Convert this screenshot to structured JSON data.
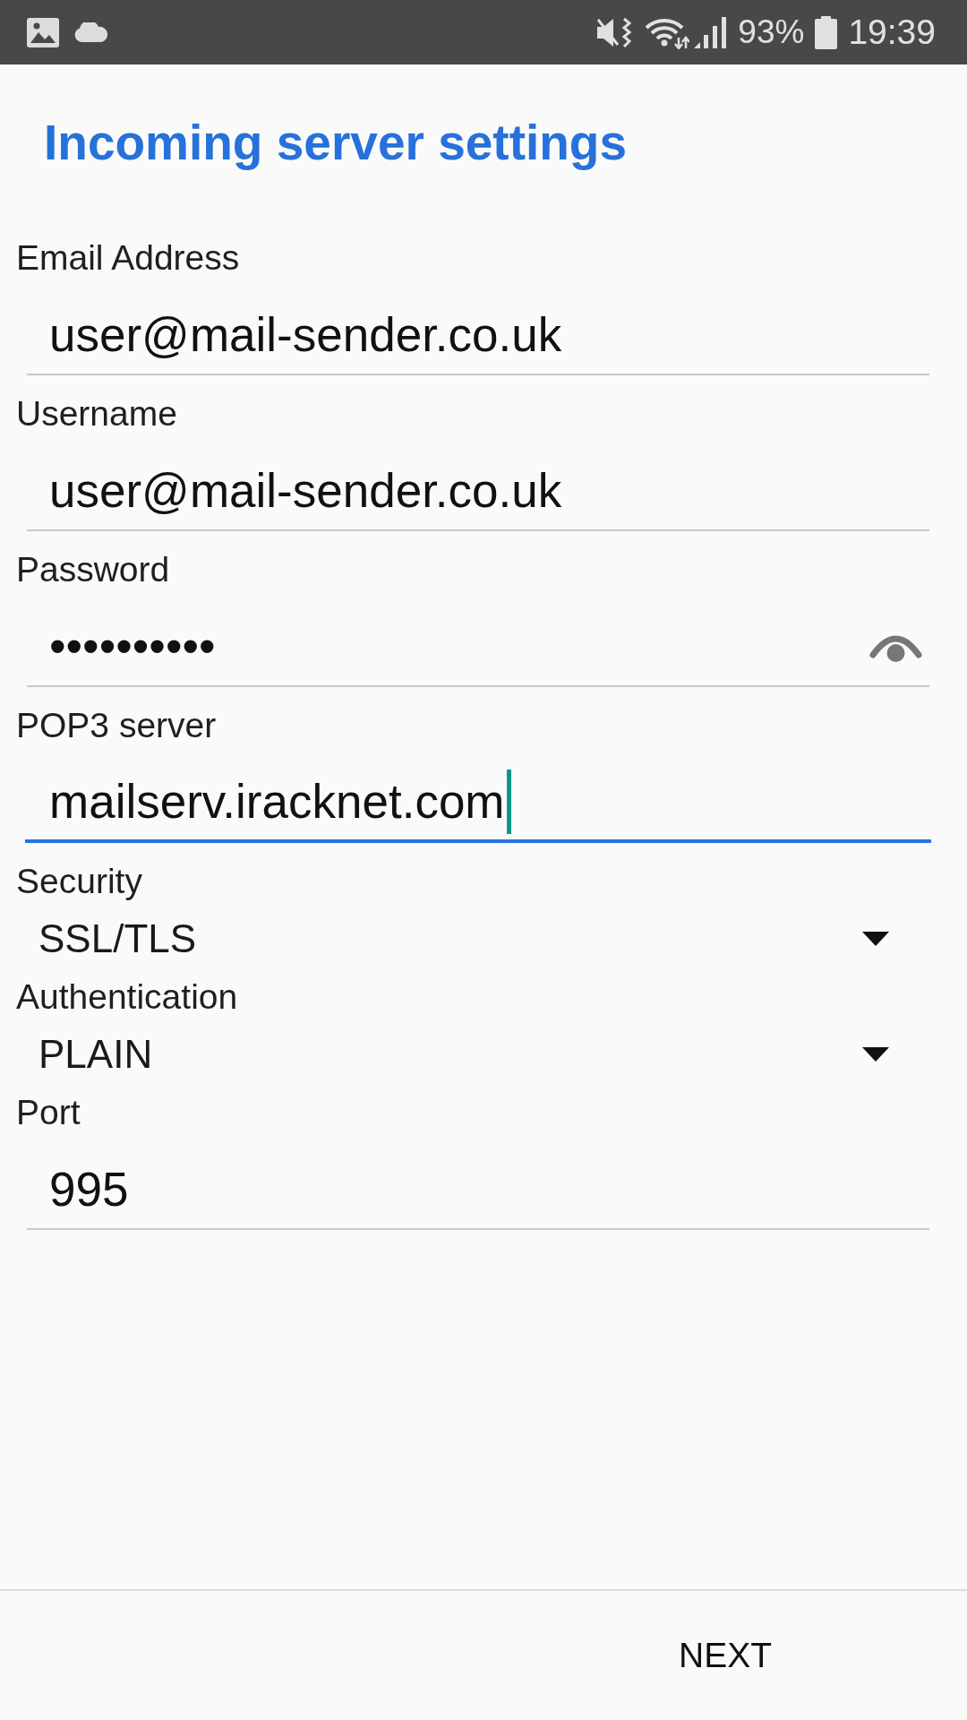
{
  "status_bar": {
    "battery_percent": "93%",
    "time": "19:39"
  },
  "title": "Incoming server settings",
  "fields": [
    {
      "kind": "text",
      "label": "Email Address",
      "value": "user@mail-sender.co.uk",
      "focused": false
    },
    {
      "kind": "text",
      "label": "Username",
      "value": "user@mail-sender.co.uk",
      "focused": false
    },
    {
      "kind": "password",
      "label": "Password",
      "value": "••••••••••",
      "focused": false
    },
    {
      "kind": "text",
      "label": "POP3 server",
      "value": "mailserv.iracknet.com",
      "focused": true
    },
    {
      "kind": "select",
      "label": "Security",
      "value": "SSL/TLS",
      "focused": false
    },
    {
      "kind": "select",
      "label": "Authentication",
      "value": "PLAIN",
      "focused": false
    },
    {
      "kind": "text",
      "label": "Port",
      "value": "995",
      "focused": false
    }
  ],
  "buttons": [
    {
      "label": "NEXT"
    }
  ]
}
